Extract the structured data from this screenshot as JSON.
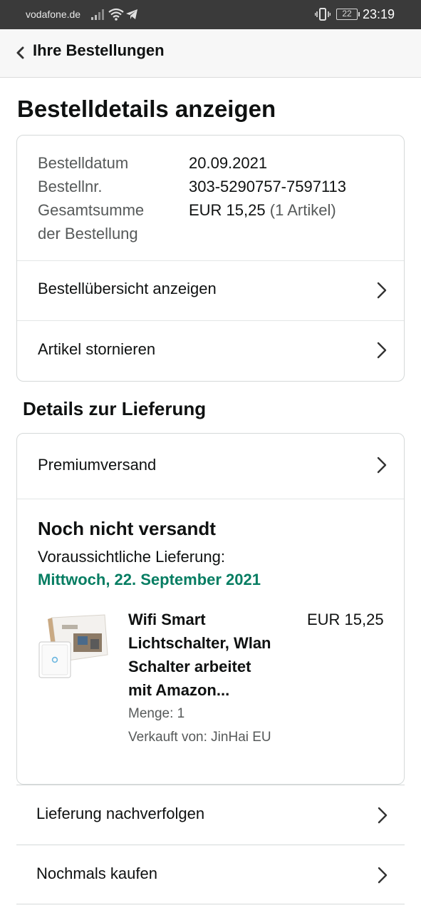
{
  "status_bar": {
    "carrier": "vodafone.de",
    "battery": "22",
    "time": "23:19",
    "icons": [
      "signal-icon",
      "wifi-icon",
      "telegram-icon",
      "vibrate-icon",
      "battery-icon"
    ]
  },
  "nav": {
    "back_label": "Ihre Bestellungen",
    "icon": "chevron-left-icon"
  },
  "page": {
    "title": "Bestelldetails anzeigen"
  },
  "order_info": {
    "date_label": "Bestelldatum",
    "date_value": "20.09.2021",
    "number_label": "Bestellnr.",
    "number_value": "303-5290757-7597113",
    "total_label_line1": "Gesamtsumme",
    "total_label_line2": "der Bestellung",
    "total_value": "EUR 15,25",
    "total_count": "(1 Artikel)"
  },
  "order_actions": [
    {
      "label": "Bestellübersicht anzeigen"
    },
    {
      "label": "Artikel stornieren"
    }
  ],
  "delivery": {
    "section_title": "Details zur Lieferung",
    "shipping_method": "Premiumversand",
    "status": "Noch nicht versandt",
    "eta_label": "Voraussichtliche Lieferung:",
    "eta_date": "Mittwoch, 22. September 2021",
    "accent_color": "#067d62"
  },
  "item": {
    "title_lines": [
      "Wifi Smart",
      "Lichtschalter, Wlan",
      "Schalter arbeitet",
      "mit Amazon..."
    ],
    "price": "EUR 15,25",
    "quantity": "Menge: 1",
    "seller": "Verkauft von: JinHai EU"
  },
  "bottom_actions": [
    {
      "label": "Lieferung nachverfolgen"
    },
    {
      "label": "Nochmals kaufen"
    }
  ]
}
